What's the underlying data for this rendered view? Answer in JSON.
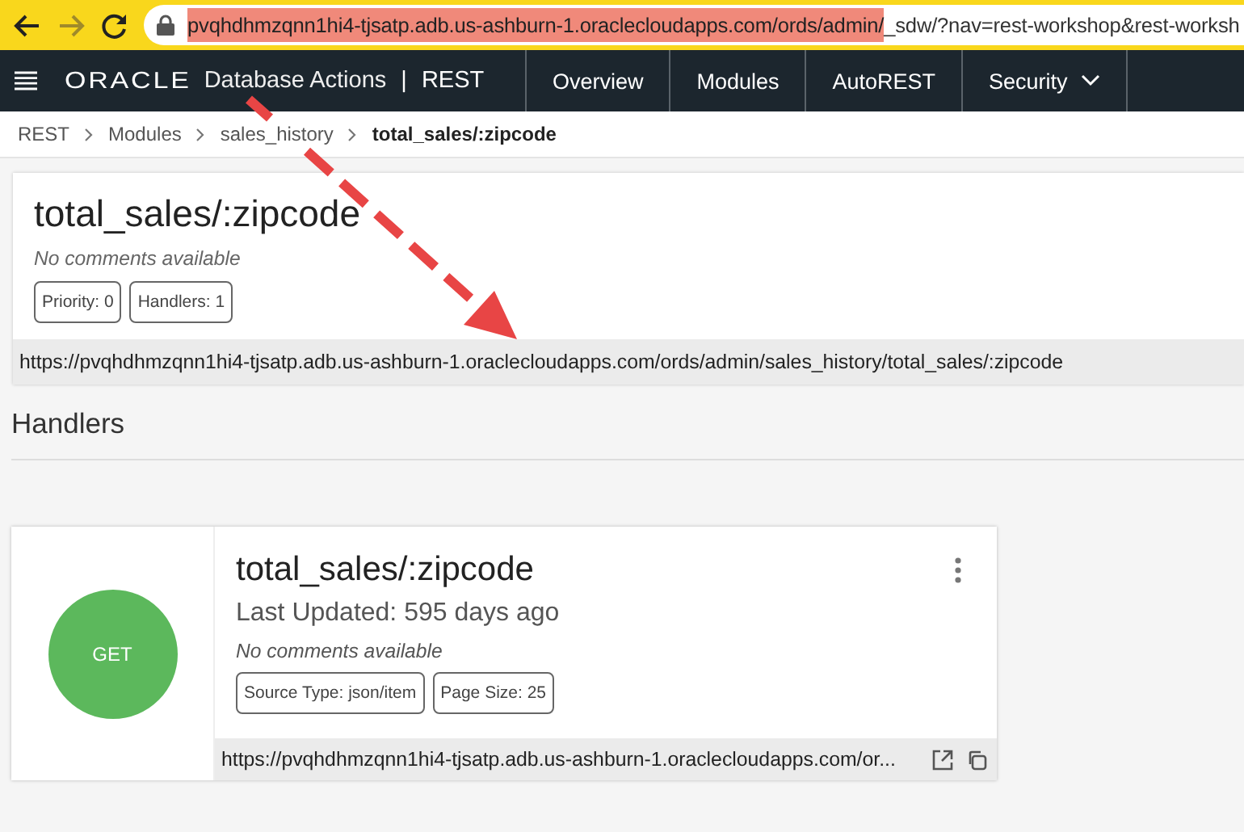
{
  "browser": {
    "address_highlighted": "pvqhdhmzqnn1hi4-tjsatp.adb.us-ashburn-1.oraclecloudapps.com/ords/admin/",
    "address_rest": "_sdw/?nav=rest-workshop&rest-worksh"
  },
  "navbar": {
    "logo": "ORACLE",
    "app": "Database Actions",
    "separator": "|",
    "section": "REST",
    "items": [
      {
        "label": "Overview",
        "kind": "link"
      },
      {
        "label": "Modules",
        "kind": "link"
      },
      {
        "label": "AutoREST",
        "kind": "link"
      },
      {
        "label": "Security",
        "kind": "dropdown"
      }
    ]
  },
  "breadcrumb": [
    {
      "label": "REST",
      "current": false
    },
    {
      "label": "Modules",
      "current": false
    },
    {
      "label": "sales_history",
      "current": false
    },
    {
      "label": "total_sales/:zipcode",
      "current": true
    }
  ],
  "resource": {
    "title": "total_sales/:zipcode",
    "comment": "No comments available",
    "badges": [
      "Priority: 0",
      "Handlers: 1"
    ],
    "url": "https://pvqhdhmzqnn1hi4-tjsatp.adb.us-ashburn-1.oraclecloudapps.com/ords/admin/sales_history/total_sales/:zipcode"
  },
  "handlers_heading": "Handlers",
  "handlers": [
    {
      "method": "GET",
      "title": "total_sales/:zipcode",
      "updated": "Last Updated: 595 days ago",
      "comment": "No comments available",
      "badges": [
        "Source Type: json/item",
        "Page Size: 25"
      ],
      "url": "https://pvqhdhmzqnn1hi4-tjsatp.adb.us-ashburn-1.oraclecloudapps.com/or..."
    }
  ]
}
